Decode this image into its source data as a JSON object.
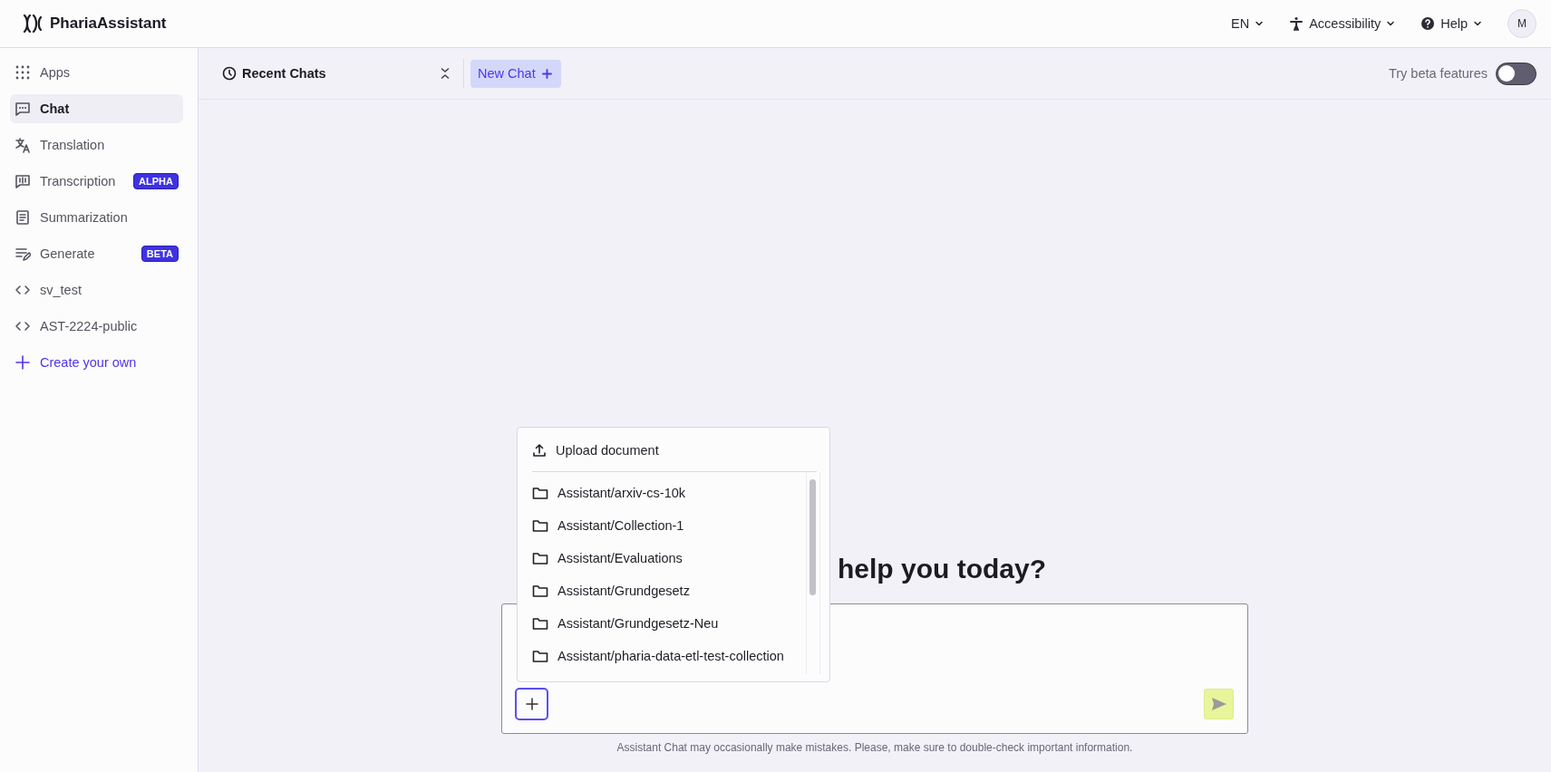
{
  "header": {
    "app_name": "PhariaAssistant",
    "language": "EN",
    "accessibility": "Accessibility",
    "help": "Help",
    "avatar": "M"
  },
  "sidebar": {
    "items": [
      {
        "kind": "apps",
        "label": "Apps",
        "selected": false
      },
      {
        "kind": "chat",
        "label": "Chat",
        "selected": true
      },
      {
        "kind": "translation",
        "label": "Translation",
        "selected": false
      },
      {
        "kind": "transcription",
        "label": "Transcription",
        "badge": "ALPHA",
        "selected": false
      },
      {
        "kind": "summarization",
        "label": "Summarization",
        "selected": false
      },
      {
        "kind": "generate",
        "label": "Generate",
        "badge": "BETA",
        "selected": false
      },
      {
        "kind": "code",
        "label": "sv_test",
        "selected": false
      },
      {
        "kind": "code",
        "label": "AST-2224-public",
        "selected": false
      },
      {
        "kind": "create",
        "label": "Create your own",
        "selected": false
      }
    ]
  },
  "toolbar": {
    "recent_chats": "Recent Chats",
    "new_chat": "New Chat",
    "beta_label": "Try beta features",
    "beta_on": false
  },
  "chat": {
    "heading": "help you today?",
    "menu": {
      "upload": "Upload document",
      "folders": [
        "Assistant/arxiv-cs-10k",
        "Assistant/Collection-1",
        "Assistant/Evaluations",
        "Assistant/Grundgesetz",
        "Assistant/Grundgesetz-Neu",
        "Assistant/pharia-data-etl-test-collection"
      ]
    },
    "disclaimer": "Assistant Chat may occasionally make mistakes. Please, make sure to double-check important information."
  }
}
